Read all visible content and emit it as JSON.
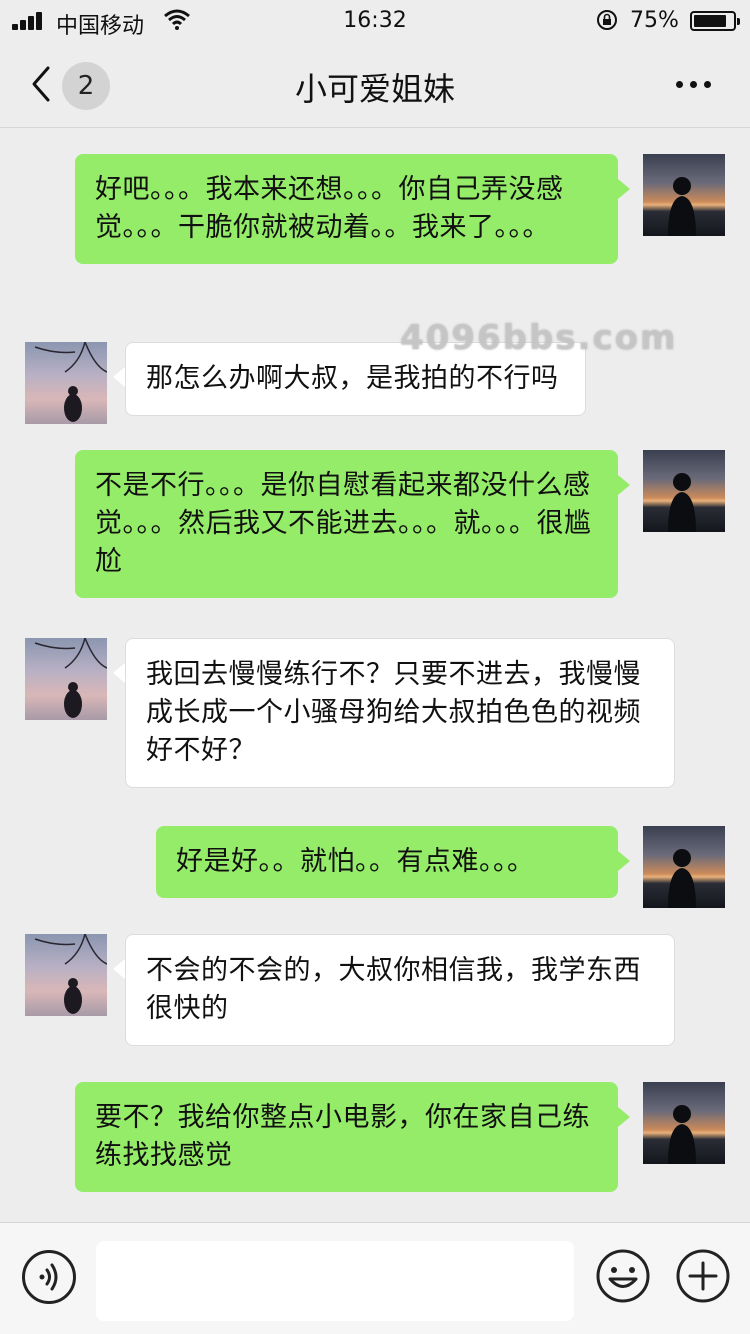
{
  "status_bar": {
    "carrier": "中国移动",
    "time": "16:32",
    "battery": "75%"
  },
  "nav": {
    "unread_count": "2",
    "title": "小可爱姐妹"
  },
  "watermark": "4096bbs.com",
  "messages": [
    {
      "from": "me",
      "text": "好吧。。。我本来还想。。。你自己弄没感觉。。。干脆你就被动着。。我来了。。。"
    },
    {
      "from": "her",
      "text": "那怎么办啊大叔，是我拍的不行吗"
    },
    {
      "from": "me",
      "text": "不是不行。。。是你自慰看起来都没什么感觉。。。然后我又不能进去。。。就。。。很尴尬"
    },
    {
      "from": "her",
      "text": "我回去慢慢练行不？只要不进去，我慢慢成长成一个小骚母狗给大叔拍色色的视频好不好？"
    },
    {
      "from": "me",
      "text": "好是好。。就怕。。有点难。。。"
    },
    {
      "from": "her",
      "text": "不会的不会的，大叔你相信我，我学东西很快的"
    },
    {
      "from": "me",
      "text": "要不？我给你整点小电影，你在家自己练练找找感觉"
    }
  ],
  "input": {
    "value": ""
  },
  "icons": {
    "back": "chevron-left-icon",
    "more": "more-dots-icon",
    "voice": "voice-icon",
    "emoji": "emoji-icon",
    "plus": "plus-icon"
  },
  "colors": {
    "my_bubble": "#95ec69",
    "her_bubble": "#ffffff",
    "background": "#ededed"
  }
}
